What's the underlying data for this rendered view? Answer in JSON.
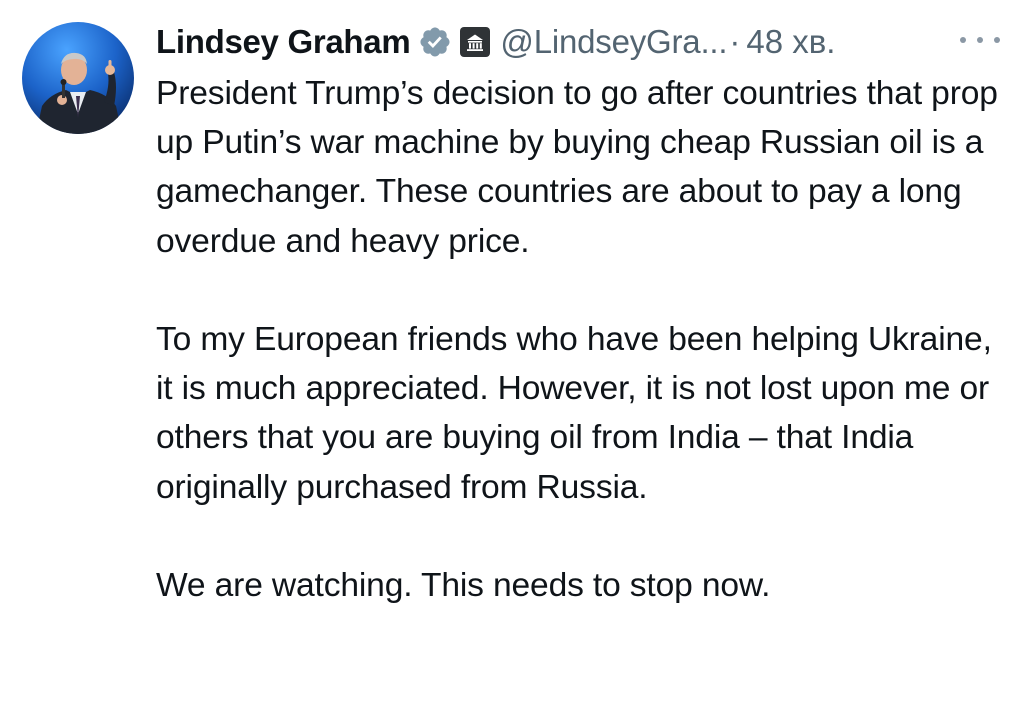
{
  "author": {
    "name": "Lindsey Graham",
    "handle": "@LindseyGra...",
    "separator": "·",
    "time": "48 хв.",
    "verified_icon": "verified-badge-icon",
    "affiliation_icon": "government-building-icon"
  },
  "tweet": {
    "paragraphs": [
      "President Trump’s decision to go after countries that prop up Putin’s war machine by buying cheap Russian oil is a gamechanger. These countries are about to pay a long overdue and heavy price.",
      "To my European friends who have been helping Ukraine, it is much appreciated.  However,  it is not lost upon me or others that you are buying oil from India – that India originally purchased from Russia.",
      "We are watching. This needs to stop now."
    ]
  },
  "colors": {
    "text": "#0f1419",
    "secondary": "#536471",
    "verified_fill": "#829aab",
    "background": "#ffffff"
  },
  "more_icon": "more-horizontal-icon"
}
